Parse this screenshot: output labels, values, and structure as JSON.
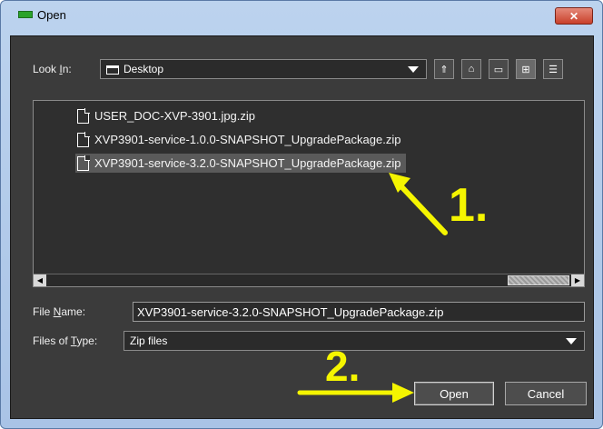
{
  "window": {
    "title": "Open",
    "close_glyph": "✕"
  },
  "look_in": {
    "label_prefix": "Look ",
    "label_mnemonic": "I",
    "label_suffix": "n:",
    "value": "Desktop"
  },
  "toolbar": {
    "buttons": [
      {
        "name": "up-one-level-icon",
        "glyph": "⇑"
      },
      {
        "name": "home-icon",
        "glyph": "⌂"
      },
      {
        "name": "new-folder-icon",
        "glyph": "▭"
      },
      {
        "name": "list-view-icon",
        "glyph": "⊞"
      },
      {
        "name": "details-view-icon",
        "glyph": "☰"
      }
    ]
  },
  "files": [
    {
      "name": "USER_DOC-XVP-3901.jpg.zip",
      "selected": false
    },
    {
      "name": "XVP3901-service-1.0.0-SNAPSHOT_UpgradePackage.zip",
      "selected": false
    },
    {
      "name": "XVP3901-service-3.2.0-SNAPSHOT_UpgradePackage.zip",
      "selected": true
    }
  ],
  "file_name": {
    "label_prefix": "File ",
    "label_mnemonic": "N",
    "label_suffix": "ame:",
    "value": "XVP3901-service-3.2.0-SNAPSHOT_UpgradePackage.zip"
  },
  "files_of_type": {
    "label_prefix": "Files of ",
    "label_mnemonic": "T",
    "label_suffix": "ype:",
    "value": "Zip files"
  },
  "buttons": {
    "open": "Open",
    "cancel": "Cancel"
  },
  "annotations": {
    "step1": "1.",
    "step2": "2.",
    "color": "#f5f500"
  },
  "colors": {
    "dialog_bg": "#3b3b3b",
    "title_bg": "#bcd3ee",
    "close_bg": "#c9402b"
  }
}
